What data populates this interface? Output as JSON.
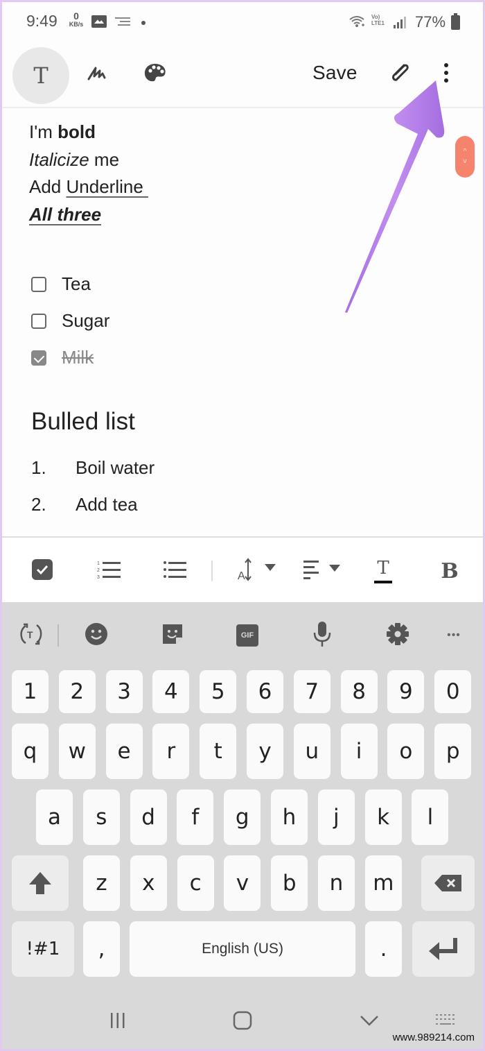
{
  "status_bar": {
    "time": "9:49",
    "network_speed_value": "0",
    "network_speed_unit": "KB/s",
    "notification_icons": [
      "gallery-icon",
      "message-icon",
      "dot-icon"
    ],
    "lte_label_top": "Vo)",
    "lte_label_bottom": "LTE1",
    "battery_percent": "77%"
  },
  "toolbar": {
    "text_mode_label": "T",
    "save_label": "Save",
    "icons": [
      "text-format-icon",
      "handwriting-icon",
      "palette-icon",
      "attach-icon",
      "more-options-icon"
    ]
  },
  "editor": {
    "lines": [
      {
        "plain": "I'm ",
        "styled": "bold",
        "style": "bold"
      },
      {
        "styled": "Italicize",
        "plain": " me",
        "style": "italic"
      },
      {
        "plain": "Add ",
        "styled": "Underline ",
        "style": "underline"
      },
      {
        "styled": "All three",
        "style": "bold-italic-underline"
      }
    ],
    "checklist": [
      {
        "label": "Tea",
        "checked": false
      },
      {
        "label": "Sugar",
        "checked": false
      },
      {
        "label": "Milk",
        "checked": true
      }
    ],
    "heading": "Bulled list",
    "numbered_list": [
      {
        "number": "1.",
        "label": "Boil water"
      },
      {
        "number": "2.",
        "label": "Add tea"
      }
    ]
  },
  "scroll_handle": {
    "up": "^",
    "down": "v"
  },
  "format_toolbar": {
    "items": [
      "checkbox-icon",
      "numbered-list-icon",
      "bullet-list-icon",
      "font-size-icon",
      "align-icon",
      "text-color-icon",
      "bold-icon"
    ],
    "bold_label": "B",
    "text_color_label": "T",
    "font_size_label": "A"
  },
  "keyboard": {
    "toolbar": [
      "translate-icon",
      "emoji-icon",
      "sticker-icon",
      "gif-icon",
      "mic-icon",
      "settings-icon",
      "more-icon"
    ],
    "gif_label": "GIF",
    "translate_label": "T",
    "more_label": "•••",
    "row_numbers": [
      "1",
      "2",
      "3",
      "4",
      "5",
      "6",
      "7",
      "8",
      "9",
      "0"
    ],
    "row_1": [
      "q",
      "w",
      "e",
      "r",
      "t",
      "y",
      "u",
      "i",
      "o",
      "p"
    ],
    "row_2": [
      "a",
      "s",
      "d",
      "f",
      "g",
      "h",
      "j",
      "k",
      "l"
    ],
    "row_3": [
      "z",
      "x",
      "c",
      "v",
      "b",
      "n",
      "m"
    ],
    "symbols_label": "!#1",
    "comma_label": ",",
    "space_label": "English (US)",
    "period_label": ".",
    "accent_color": "#f6836b"
  },
  "nav_bar": {
    "items": [
      "recents-icon",
      "home-icon",
      "back-icon",
      "keyboard-icon"
    ]
  },
  "watermark": "www.989214.com",
  "annotation": {
    "arrow_color": "#b67ee8",
    "points_to": "more-options-icon"
  }
}
